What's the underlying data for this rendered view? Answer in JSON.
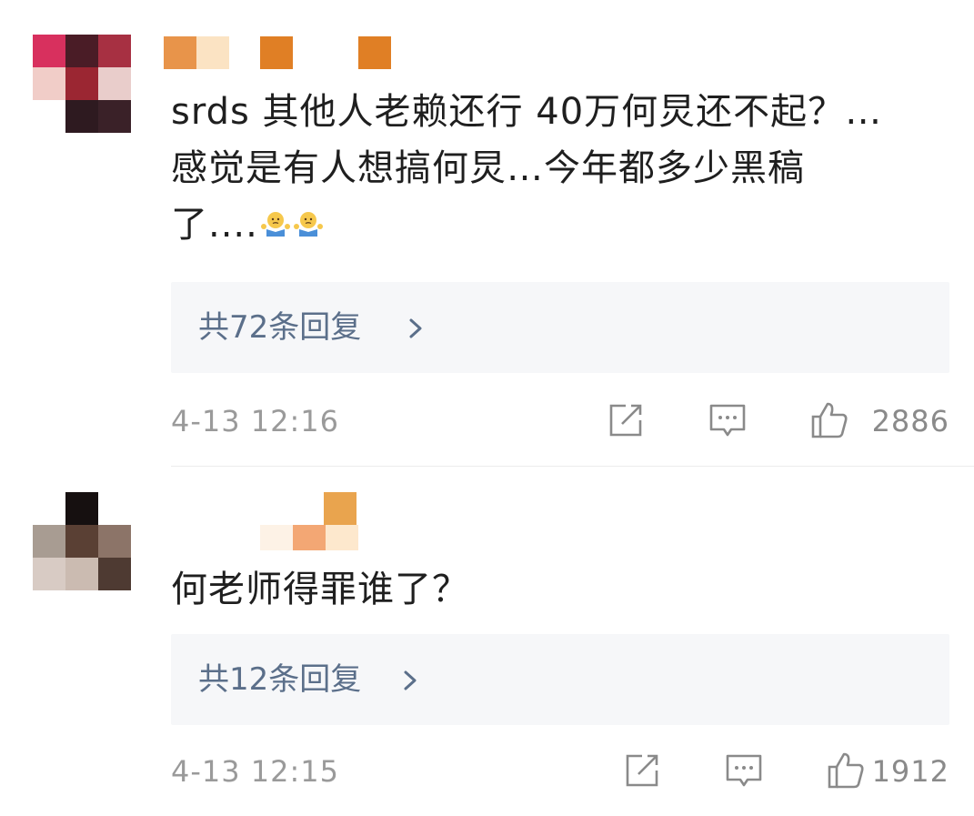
{
  "comments": [
    {
      "text": "srds 其他人老赖还行 40万何炅还不起？…\n感觉是有人想搞何炅…今年都多少黑稿\n了....",
      "emoji": [
        "shrug-emoji",
        "shrug-emoji"
      ],
      "reply_label": "共72条回复",
      "time": "4-13 12:16",
      "likes": "2886"
    },
    {
      "text": "何老师得罪谁了？",
      "emoji": [],
      "reply_label": "共12条回复",
      "time": "4-13 12:15",
      "likes": "1912"
    }
  ],
  "icons": {
    "share": "share-icon",
    "comment": "comment-icon",
    "like": "thumbs-up-icon",
    "reply_chevron": "chevron-right-icon"
  },
  "colors": {
    "text": "#1f1f1f",
    "reply_link": "#5b6f8a",
    "meta": "#9a9a9a",
    "reply_bg": "#f6f7f9"
  }
}
